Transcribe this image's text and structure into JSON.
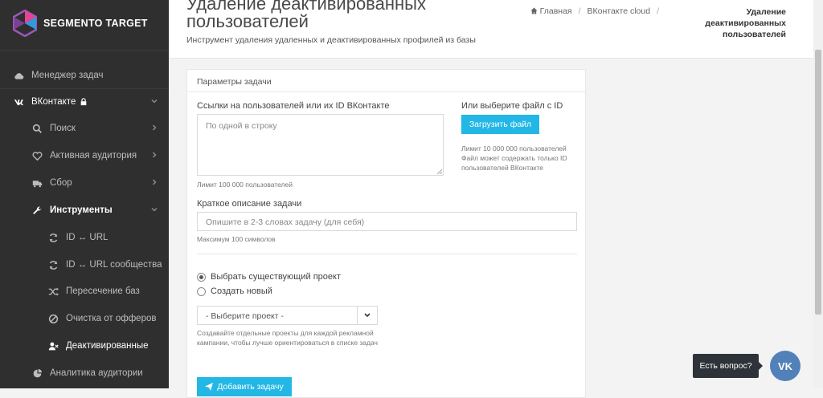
{
  "app": {
    "logo_text": "SEGMENTO TARGET"
  },
  "sidebar": {
    "items": [
      {
        "label": "Менеджер задач",
        "icon": "cloud-icon"
      },
      {
        "label": "ВКонтакте",
        "icon": "vk-icon",
        "badge_icon": "lock-icon"
      },
      {
        "label": "Поиск",
        "icon": "search-icon"
      },
      {
        "label": "Активная аудитория",
        "icon": "heart-icon"
      },
      {
        "label": "Сбор",
        "icon": "truck-icon"
      },
      {
        "label": "Инструменты",
        "icon": "wrench-icon"
      },
      {
        "label": "ID ↔ URL",
        "icon": "refresh-icon"
      },
      {
        "label": "ID ↔ URL сообщества",
        "icon": "refresh-icon"
      },
      {
        "label": "Пересечение баз",
        "icon": "shuffle-icon"
      },
      {
        "label": "Очистка от офферов",
        "icon": "ban-icon"
      },
      {
        "label": "Деактивированные",
        "icon": "user-x-icon"
      },
      {
        "label": "Аналитика аудитории",
        "icon": "pie-chart-icon"
      }
    ]
  },
  "header": {
    "title": "Удаление деактивированных пользователей",
    "subtitle": "Инструмент удаления удаленных и деактивированных профилей из базы",
    "breadcrumb": [
      "Главная",
      "ВКонтакте cloud",
      "Удаление деактивированных пользователей"
    ]
  },
  "panel": {
    "heading": "Параметры задачи",
    "links_label": "Ссылки на пользователей или их ID ВКонтакте",
    "links_placeholder": "По одной в строку",
    "links_hint": "Лимит 100 000 пользователей",
    "file_label": "Или выберите файл с ID",
    "upload_button": "Загрузить файл",
    "file_hint_1": "Лимит 10 000 000 пользователей",
    "file_hint_2": "Файл может содержать только ID пользователей ВКонтакте",
    "desc_label": "Краткое описание задачи",
    "desc_placeholder": "Опишите в 2-3 словах задачу (для себя)",
    "desc_hint": "Максимум 100 символов",
    "radio_existing": "Выбрать существующий проект",
    "radio_new": "Создать новый",
    "project_select": "- Выберите проект -",
    "project_hint": "Создавайте отдельные проекты для каждой рекламной кампании, чтобы лучше ориентироваться в списке задач",
    "add_button": "Добавить задачу"
  },
  "chat": {
    "tooltip": "Есть вопрос?",
    "button_text": "VK"
  },
  "colors": {
    "accent": "#23b7e5",
    "sidebar_bg": "#2f2f2f",
    "vk_blue": "#5181b8"
  }
}
